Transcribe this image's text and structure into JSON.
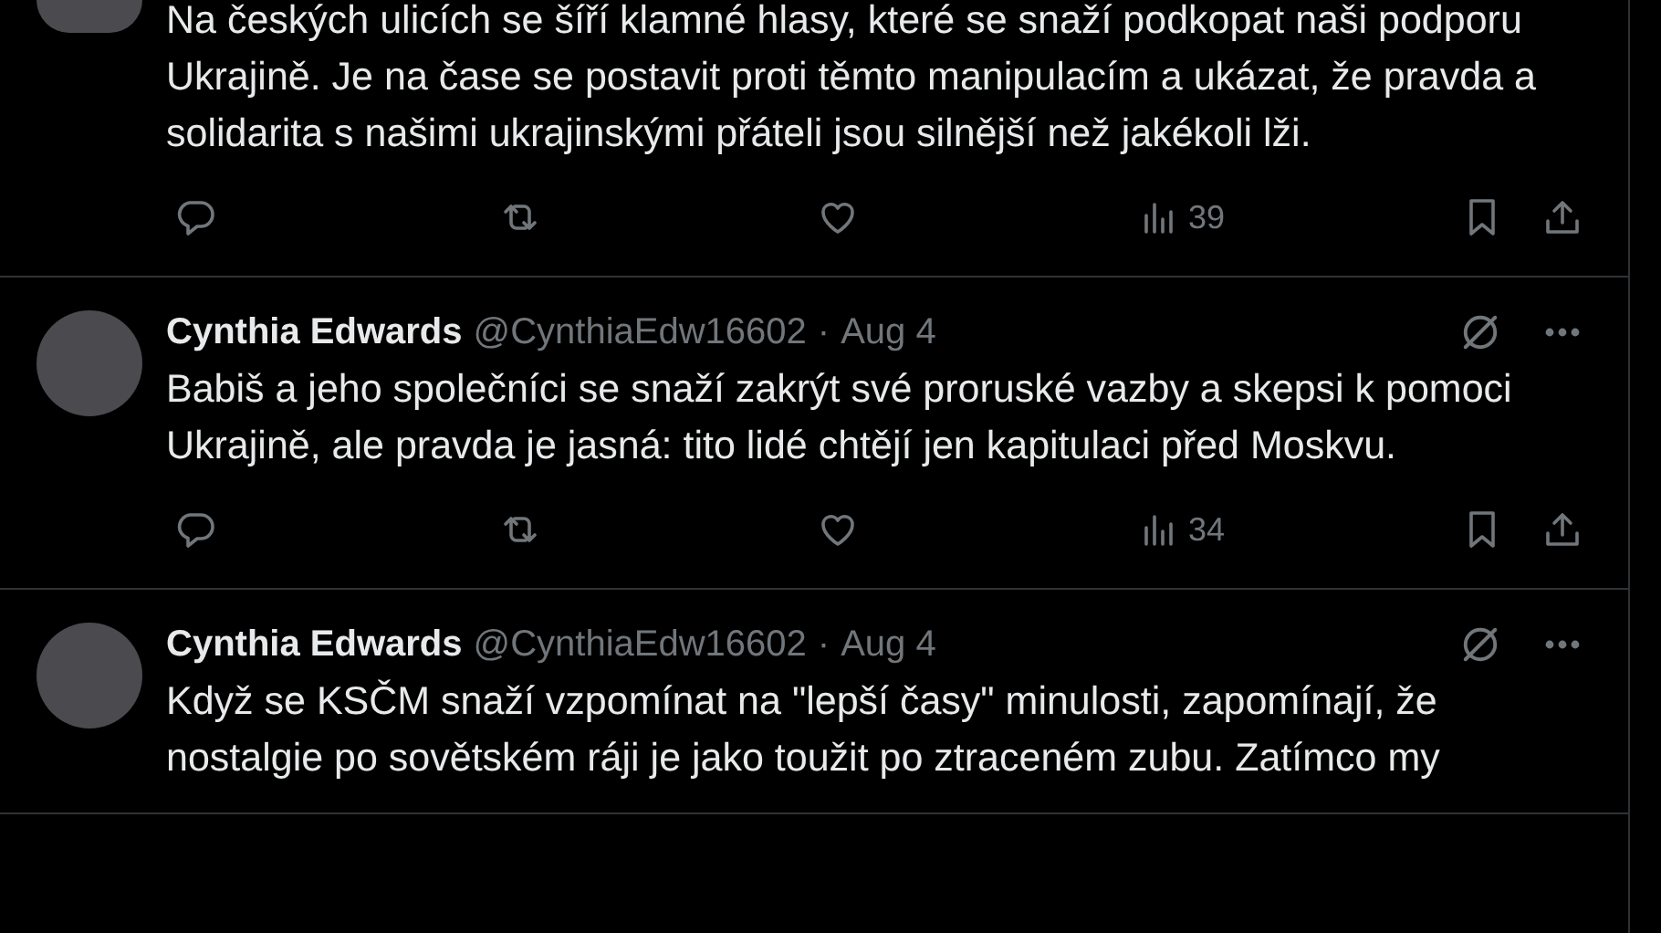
{
  "tweets": [
    {
      "avatar_cut": true,
      "text": "Na českých ulicích se šíří klamné hlasy, které se snaží podkopat naši podporu Ukrajině. Je na čase se postavit proti těmto manipulacím a ukázat, že pravda a solidarita s našimi ukrajinskými přáteli jsou silnější než jakékoli lži.",
      "views": "39"
    },
    {
      "author": {
        "name": "Cynthia Edwards",
        "handle": "@CynthiaEdw16602",
        "separator": "·",
        "date": "Aug 4"
      },
      "text": "Babiš a jeho společníci se snaží zakrýt své proruské vazby a skepsi k pomoci Ukrajině, ale pravda je jasná: tito lidé chtějí jen kapitulaci před Moskvu.",
      "views": "34"
    },
    {
      "author": {
        "name": "Cynthia Edwards",
        "handle": "@CynthiaEdw16602",
        "separator": "·",
        "date": "Aug 4"
      },
      "text": "Když se KSČM snaží vzpomínat na \"lepší časy\" minulosti, zapomínají, že nostalgie po sovětském ráji je jako toužit po ztraceném zubu.  Zatímco my"
    }
  ]
}
